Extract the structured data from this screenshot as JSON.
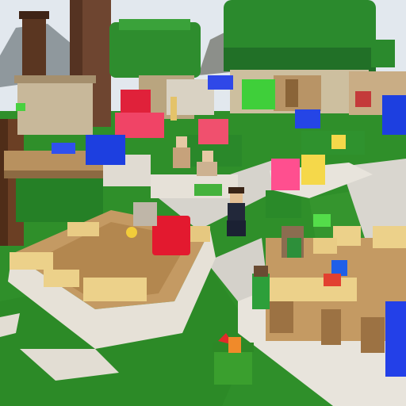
{
  "scene": {
    "description_hidden": "",
    "palette": {
      "sky": "#dfe6ec",
      "mountain": "#9aa3a8",
      "grass": "#2f8f2a",
      "grass_light": "#46a83a",
      "path": "#d9d6cf",
      "wood": "#b88a55",
      "wood_dark": "#7a5532",
      "plank": "#e2c27a",
      "stone": "#e8e4dc",
      "leaves": "#2c8a2c",
      "leaves_dark": "#1f6b22",
      "red_block": "#e0213a",
      "pink_block": "#f0506e",
      "blue_block": "#1d3fe0",
      "green_block": "#3fcf3a",
      "yellow_block": "#f5d84a",
      "magenta_block": "#ff4f8f"
    }
  }
}
